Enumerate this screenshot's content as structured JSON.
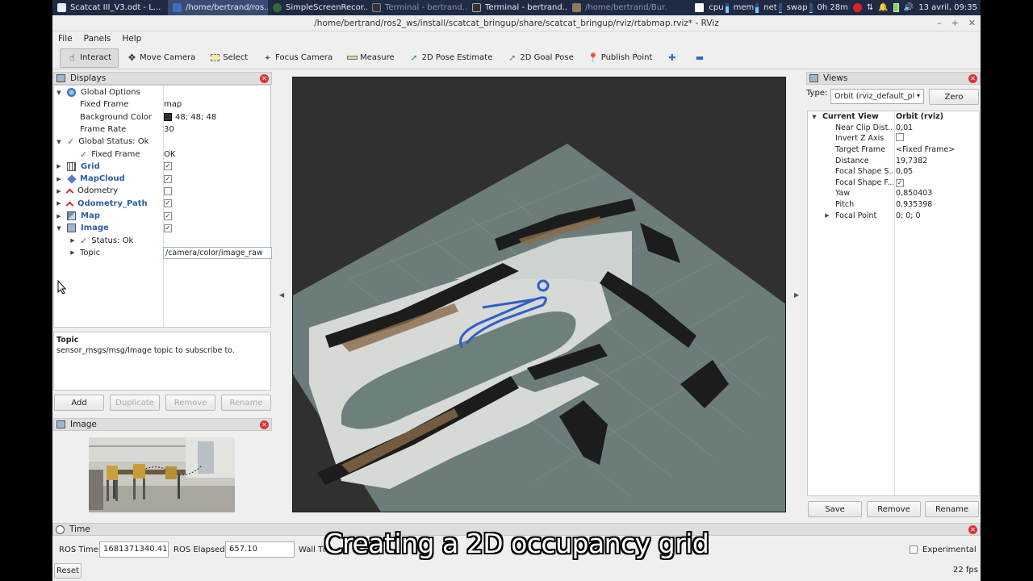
{
  "taskbar": {
    "items": [
      {
        "label": "Scatcat III_V3.odt - L...",
        "state": "normal"
      },
      {
        "label": "/home/bertrand/ros...",
        "state": "active"
      },
      {
        "label": "SimpleScreenRecor...",
        "state": "normal"
      },
      {
        "label": "Terminal - bertrand...",
        "state": "dim"
      },
      {
        "label": "Terminal - bertrand...",
        "state": "normal"
      },
      {
        "label": "/home/bertrand/Bur...",
        "state": "dim"
      }
    ],
    "monitors": [
      {
        "label": "cpu",
        "level": 0.7
      },
      {
        "label": "mem",
        "level": 0.55
      },
      {
        "label": "net",
        "level": 0.1
      },
      {
        "label": "swap",
        "level": 0.05
      }
    ],
    "uptime": "0h 28m",
    "datetime": "13 avril, 09:35"
  },
  "window": {
    "title": "/home/bertrand/ros2_ws/install/scatcat_bringup/share/scatcat_bringup/rviz/rtabmap.rviz* - RViz"
  },
  "menu": [
    "File",
    "Panels",
    "Help"
  ],
  "toolbar": [
    {
      "label": "Interact",
      "icon": "hand-icon",
      "active": true
    },
    {
      "label": "Move Camera",
      "icon": "move-camera-icon",
      "active": false
    },
    {
      "label": "Select",
      "icon": "select-icon",
      "active": false
    },
    {
      "label": "Focus Camera",
      "icon": "focus-camera-icon",
      "active": false
    },
    {
      "label": "Measure",
      "icon": "measure-icon",
      "active": false
    },
    {
      "label": "2D Pose Estimate",
      "icon": "pose-estimate-icon",
      "active": false
    },
    {
      "label": "2D Goal Pose",
      "icon": "goal-pose-icon",
      "active": false
    },
    {
      "label": "Publish Point",
      "icon": "publish-point-icon",
      "active": false
    }
  ],
  "displays": {
    "title": "Displays",
    "rows": [
      {
        "name": "Global Options",
        "value": "",
        "indent": 0,
        "expand": "open",
        "icon": "globe-icon"
      },
      {
        "name": "Fixed Frame",
        "value": "map",
        "indent": 1
      },
      {
        "name": "Background Color",
        "value": "48; 48; 48",
        "indent": 1,
        "swatch": "#303030"
      },
      {
        "name": "Frame Rate",
        "value": "30",
        "indent": 1
      },
      {
        "name": "Global Status: Ok",
        "value": "",
        "indent": 0,
        "expand": "open",
        "tick": true
      },
      {
        "name": "Fixed Frame",
        "value": "OK",
        "indent": 1,
        "tick": true
      },
      {
        "name": "Grid",
        "value": "",
        "indent": 0,
        "expand": "closed",
        "icon": "grid-icon",
        "bold": true,
        "check": true
      },
      {
        "name": "MapCloud",
        "value": "",
        "indent": 0,
        "expand": "closed",
        "icon": "cloud-icon",
        "bold": true,
        "check": true
      },
      {
        "name": "Odometry",
        "value": "",
        "indent": 0,
        "expand": "closed",
        "icon": "odometry-icon",
        "check": false
      },
      {
        "name": "Odometry_Path",
        "value": "",
        "indent": 0,
        "expand": "closed",
        "icon": "path-icon",
        "bold": true,
        "check": true
      },
      {
        "name": "Map",
        "value": "",
        "indent": 0,
        "expand": "closed",
        "icon": "map-icon",
        "bold": true,
        "check": true
      },
      {
        "name": "Image",
        "value": "",
        "indent": 0,
        "expand": "open",
        "icon": "image-icon",
        "bold": true,
        "check": true
      },
      {
        "name": "Status: Ok",
        "value": "",
        "indent": 1,
        "expand": "closed",
        "tick": true
      },
      {
        "name": "Topic",
        "value": "/camera/color/image_raw",
        "indent": 1,
        "expand": "closed",
        "input": true
      }
    ],
    "description_title": "Topic",
    "description_text": "sensor_msgs/msg/Image topic to subscribe to.",
    "buttons": {
      "add": "Add",
      "duplicate": "Duplicate",
      "remove": "Remove",
      "rename": "Rename"
    }
  },
  "image_panel": {
    "title": "Image"
  },
  "views": {
    "title": "Views",
    "type_label": "Type:",
    "type_value": "Orbit (rviz_default_pl",
    "zero_label": "Zero",
    "current_view": "Current View",
    "current_value": "Orbit (rviz)",
    "rows": [
      {
        "key": "Near Clip Dist...",
        "value": "0,01"
      },
      {
        "key": "Invert Z Axis",
        "value": "",
        "check": false
      },
      {
        "key": "Target Frame",
        "value": "<Fixed Frame>"
      },
      {
        "key": "Distance",
        "value": "19,7382"
      },
      {
        "key": "Focal Shape S...",
        "value": "0,05"
      },
      {
        "key": "Focal Shape F...",
        "value": "",
        "check": true
      },
      {
        "key": "Yaw",
        "value": "0,850403"
      },
      {
        "key": "Pitch",
        "value": "0,935398"
      },
      {
        "key": "Focal Point",
        "value": "0; 0; 0",
        "expand": true
      }
    ],
    "buttons": {
      "save": "Save",
      "remove": "Remove",
      "rename": "Rename"
    }
  },
  "time": {
    "title": "Time",
    "ros_time_label": "ROS Time:",
    "ros_time_value": "1681371340.41",
    "ros_elapsed_label": "ROS Elapsed:",
    "ros_elapsed_value": "657.10",
    "wall_time_label": "Wall Tim",
    "experimental_label": "Experimental",
    "reset_label": "Reset",
    "fps": "22 fps"
  },
  "caption": "Creating a 2D occupancy grid"
}
